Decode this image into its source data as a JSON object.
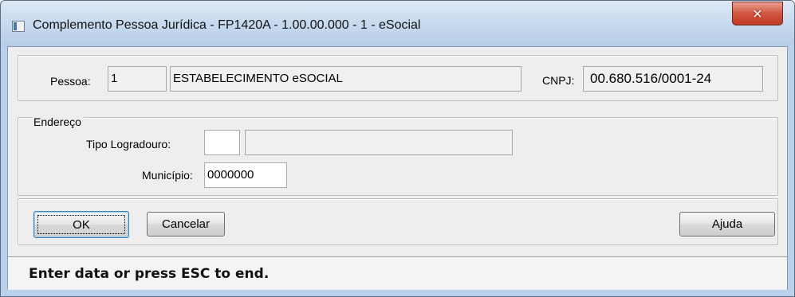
{
  "window": {
    "title": "Complemento Pessoa Jurídica - FP1420A - 1.00.00.000 - 1 - eSocial",
    "close_icon": "close-x-icon",
    "app_icon": "window-app-icon"
  },
  "pessoa": {
    "label": "Pessoa:",
    "code": "1",
    "name": "ESTABELECIMENTO eSOCIAL",
    "cnpj_label": "CNPJ:",
    "cnpj": "00.680.516/0001-24"
  },
  "endereco": {
    "legend": "Endereço",
    "tipo_logradouro_label": "Tipo Logradouro:",
    "tipo_logradouro_code": "",
    "tipo_logradouro_desc": "",
    "municipio_label": "Município:",
    "municipio": "0000000"
  },
  "buttons": {
    "ok": "OK",
    "cancel": "Cancelar",
    "help": "Ajuda"
  },
  "status": {
    "text": "Enter data or press ESC to end."
  }
}
